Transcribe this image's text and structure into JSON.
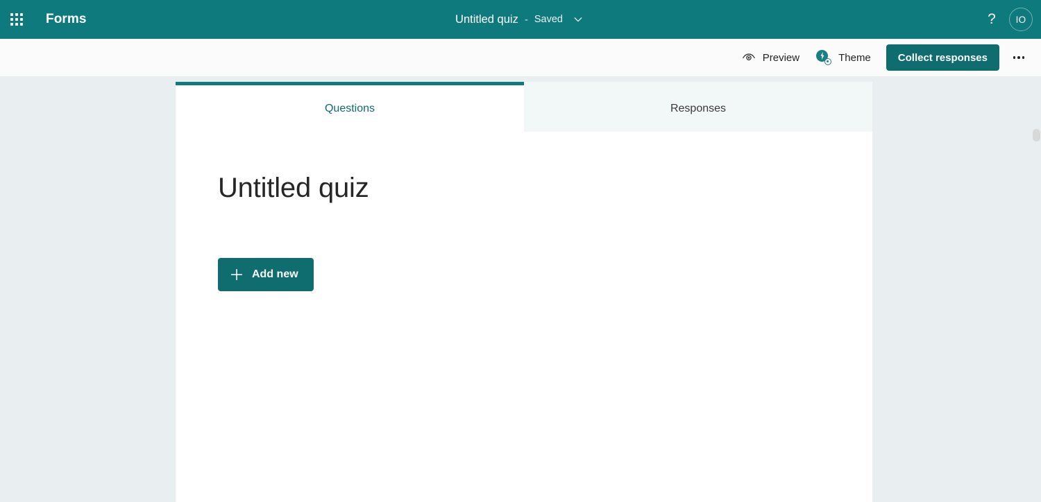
{
  "header": {
    "app_launcher_icon": "waffle-grid-icon",
    "brand": "Forms",
    "doc_title": "Untitled quiz",
    "separator": "-",
    "save_status": "Saved",
    "title_menu_icon": "chevron-down-icon",
    "help_icon": "?",
    "avatar_initials": "IO",
    "accent_color": "#0f7a7d"
  },
  "toolbar": {
    "preview_label": "Preview",
    "preview_icon": "eye-icon",
    "theme_label": "Theme",
    "theme_icon": "theme-paint-icon",
    "collect_label": "Collect responses",
    "more_icon": "more-horizontal-icon",
    "primary_color": "#0f6c6f"
  },
  "tabs": [
    {
      "label": "Questions",
      "active": true
    },
    {
      "label": "Responses",
      "active": false
    }
  ],
  "form": {
    "title": "Untitled quiz",
    "add_new_label": "Add new",
    "add_new_icon": "plus-icon"
  },
  "page": {
    "background_color": "#e9eff1",
    "card_background": "#ffffff"
  }
}
